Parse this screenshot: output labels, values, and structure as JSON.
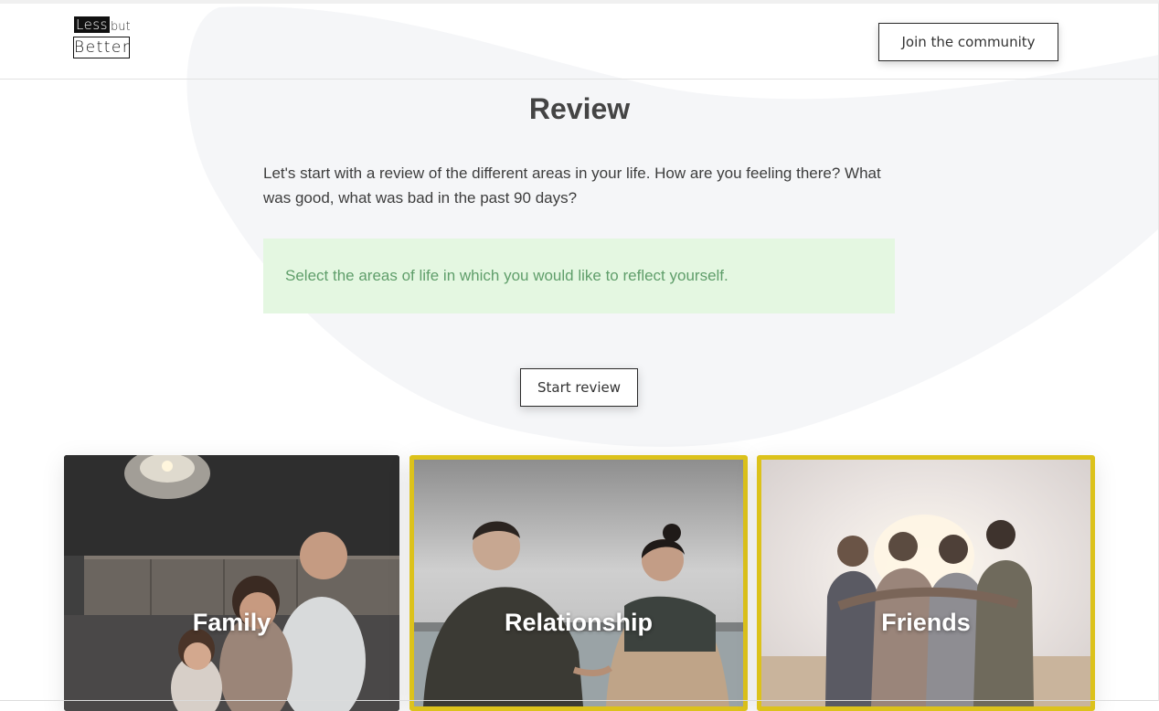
{
  "header": {
    "logo": {
      "line1": "Less",
      "line1_suffix": "but",
      "line2": "Better"
    },
    "join_button": "Join the community"
  },
  "main": {
    "title": "Review",
    "intro": "Let's start with a review of the different areas in your life. How are you feeling there? What was good, what was bad in the past 90 days?",
    "alert": "Select the areas of life in which you would like to reflect yourself.",
    "start_button": "Start review"
  },
  "areas": [
    {
      "label": "Family",
      "selected": false,
      "image": "family-kitchen-photo"
    },
    {
      "label": "Relationship",
      "selected": true,
      "image": "couple-holding-hands-photo"
    },
    {
      "label": "Friends",
      "selected": true,
      "image": "friends-sunset-photo"
    }
  ],
  "colors": {
    "selected_border": "#dcc21b",
    "alert_background": "#e4f7e1",
    "alert_text": "#5f9e6a",
    "blob": "#f5f6f8"
  }
}
